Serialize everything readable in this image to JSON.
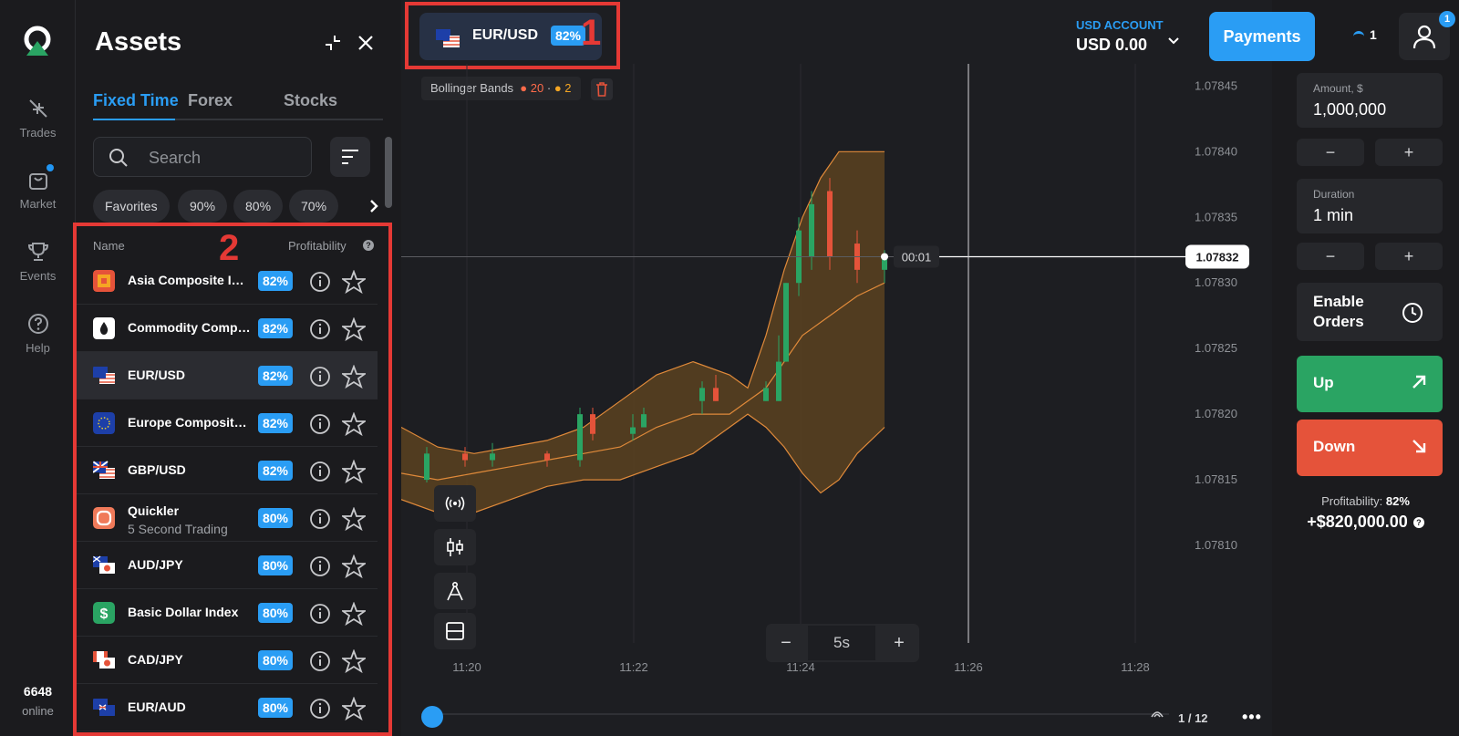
{
  "rail": {
    "items": [
      {
        "label": "Trades",
        "icon": "trades-icon"
      },
      {
        "label": "Market",
        "icon": "market-bag-icon"
      },
      {
        "label": "Events",
        "icon": "trophy-icon"
      },
      {
        "label": "Help",
        "icon": "help-icon"
      }
    ],
    "online_count": "6648",
    "online_label": "online"
  },
  "assets": {
    "title": "Assets",
    "tabs": [
      "Fixed Time",
      "Forex",
      "Stocks"
    ],
    "active_tab": "Fixed Time",
    "search_placeholder": "Search",
    "filters": [
      "Favorites",
      "90%",
      "80%",
      "70%"
    ],
    "header_name": "Name",
    "header_profitability": "Profitability",
    "header_help": "?",
    "rows": [
      {
        "name": "Asia Composite Index",
        "pct": "82%",
        "icon": "asia-composite-icon"
      },
      {
        "name": "Commodity Composite",
        "pct": "82%",
        "icon": "commodity-drop-icon"
      },
      {
        "name": "EUR/USD",
        "pct": "82%",
        "icon": "eur-usd-flag-icon"
      },
      {
        "name": "Europe Composite Index",
        "pct": "82%",
        "icon": "eu-flag-icon"
      },
      {
        "name": "GBP/USD",
        "pct": "82%",
        "icon": "gbp-usd-flag-icon"
      },
      {
        "name": "Quickler",
        "sub": "5 Second Trading",
        "pct": "80%",
        "icon": "quickler-icon"
      },
      {
        "name": "AUD/JPY",
        "pct": "80%",
        "icon": "aud-jpy-flag-icon"
      },
      {
        "name": "Basic Dollar Index",
        "pct": "80%",
        "icon": "dollar-icon"
      },
      {
        "name": "CAD/JPY",
        "pct": "80%",
        "icon": "cad-jpy-flag-icon"
      },
      {
        "name": "EUR/AUD",
        "pct": "80%",
        "icon": "eur-aud-flag-icon"
      }
    ]
  },
  "annotations": {
    "box1": "1",
    "box2": "2",
    "color": "#e53935"
  },
  "header": {
    "pair": "EUR/USD",
    "pair_pct": "82%",
    "indicator_name": "Bollinger Bands",
    "indicator_p1": "20",
    "indicator_p2": "2",
    "account_label": "USD ACCOUNT",
    "account_value": "USD 0.00",
    "payments": "Payments",
    "notifications": "1",
    "profile_badge": "1"
  },
  "chart": {
    "timer": "00:01",
    "current_price": "1.07832",
    "zoom_value": "5s",
    "zoom_minus": "−",
    "zoom_plus": "+",
    "page": "1 / 12",
    "more": "•••"
  },
  "chart_data": {
    "type": "candlestick",
    "title": "",
    "price_ticks": [
      "1.07845",
      "1.07840",
      "1.07835",
      "1.07830",
      "1.07825",
      "1.07820",
      "1.07815",
      "1.07810"
    ],
    "time_ticks": [
      "11:20",
      "11:22",
      "11:24",
      "11:26",
      "11:28"
    ],
    "ylim": [
      1.07805,
      1.07846
    ],
    "current_price": 1.07832,
    "indicator": {
      "name": "Bollinger Bands",
      "period": 20,
      "deviation": 2
    },
    "colors": {
      "up": "#2aa463",
      "down": "#e5533a",
      "band_fill": "#5a4220",
      "band_line": "#e08a3a"
    }
  },
  "trade": {
    "amount_label": "Amount, $",
    "amount_value": "1,000,000",
    "duration_label": "Duration",
    "duration_value": "1 min",
    "minus": "−",
    "plus": "+",
    "enable_orders": "Enable Orders",
    "up": "Up",
    "down": "Down",
    "profit_label": "Profitability:",
    "profit_pct": "82%",
    "profit_value": "+$820,000.00"
  }
}
